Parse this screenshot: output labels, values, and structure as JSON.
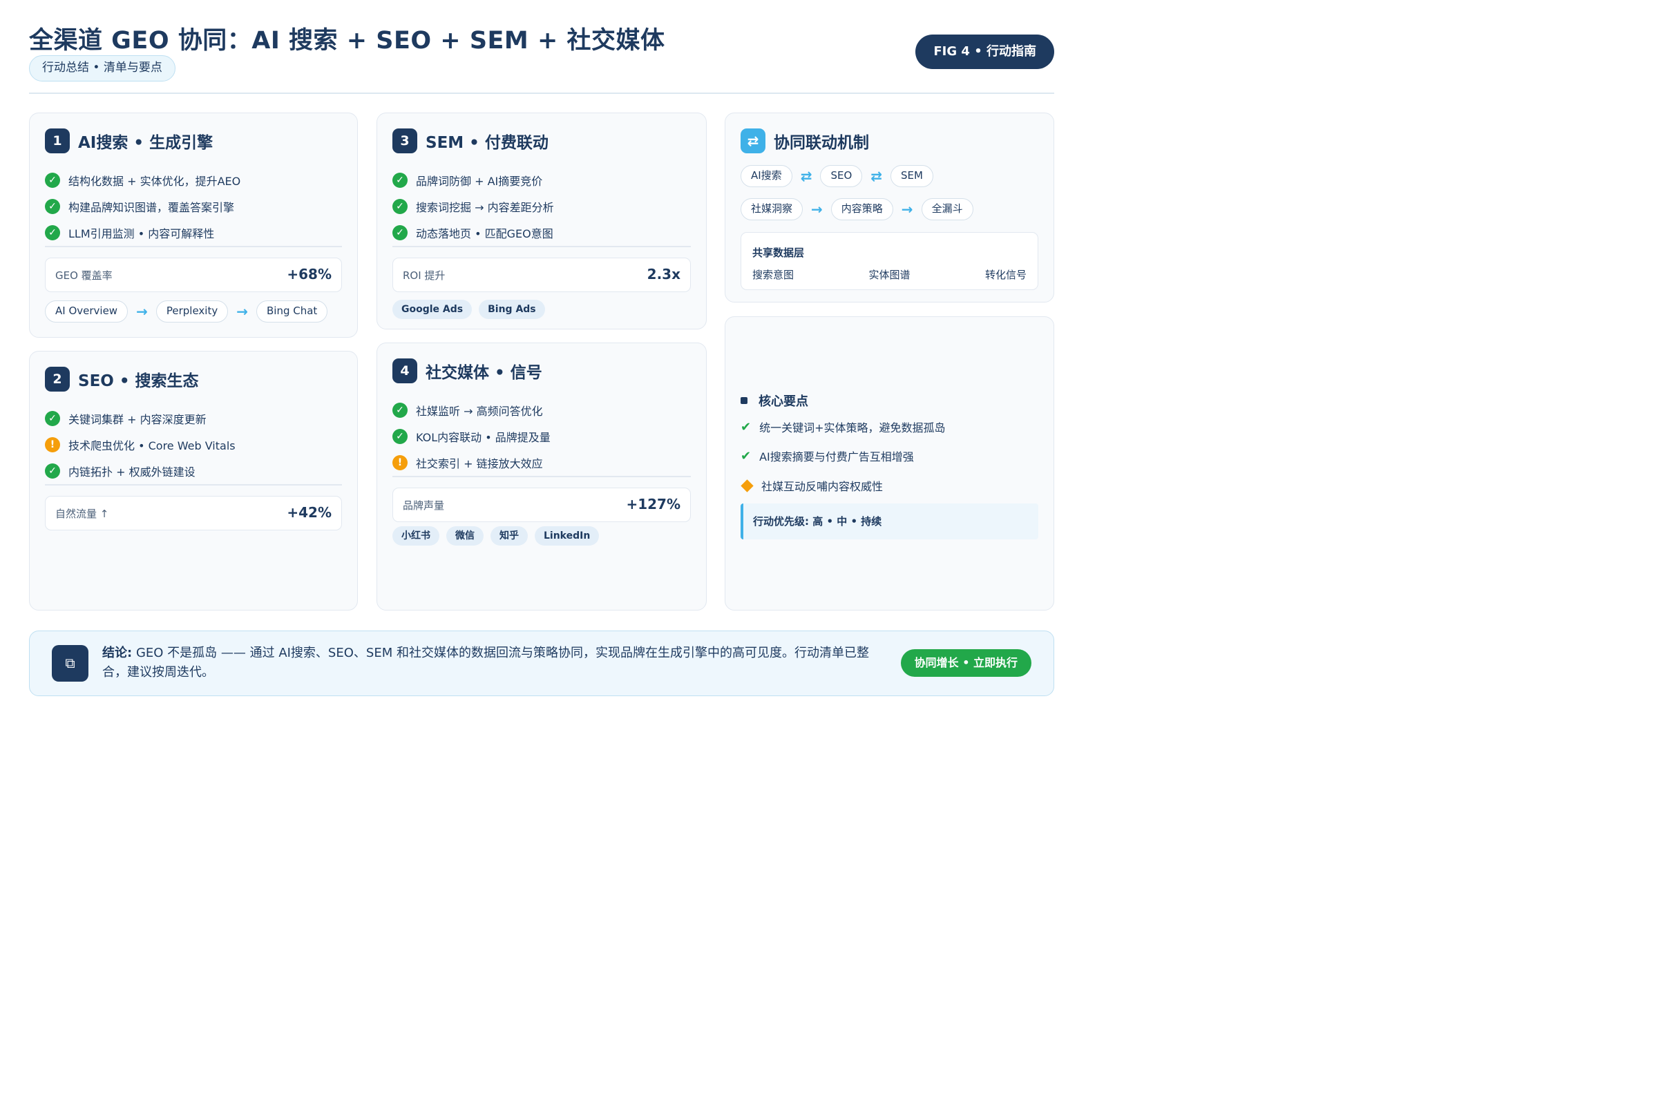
{
  "header": {
    "title": "全渠道 GEO 协同：AI 搜索 + SEO + SEM + 社交媒体",
    "subtitle": "行动总结 • 清单与要点",
    "fig_badge": "FIG 4 • 行动指南"
  },
  "cards": {
    "ai": {
      "num": "1",
      "title": "AI搜索 • 生成引擎",
      "checks": [
        "结构化数据 + 实体优化，提升AEO",
        "构建品牌知识图谱，覆盖答案引擎",
        "LLM引用监测 • 内容可解释性"
      ],
      "metric_label": "GEO 覆盖率",
      "metric_value": "+68%",
      "flow": [
        "AI Overview",
        "Perplexity",
        "Bing Chat"
      ]
    },
    "seo": {
      "num": "2",
      "title": "SEO • 搜索生态",
      "checks": [
        "关键词集群 + 内容深度更新",
        "技术爬虫优化 • Core Web Vitals",
        "内链拓扑 + 权威外链建设"
      ],
      "check_status": [
        "ok",
        "warn",
        "ok"
      ],
      "metric_label": "自然流量 ↑",
      "metric_value": "+42%"
    },
    "sem": {
      "num": "3",
      "title": "SEM • 付费联动",
      "checks": [
        "品牌词防御 + AI摘要竞价",
        "搜索词挖掘 → 内容差距分析",
        "动态落地页 • 匹配GEO意图"
      ],
      "metric_label": "ROI 提升",
      "metric_value": "2.3x",
      "tags": [
        "Google Ads",
        "Bing Ads"
      ]
    },
    "social": {
      "num": "4",
      "title": "社交媒体 • 信号",
      "checks": [
        "社媒监听 → 高频问答优化",
        "KOL内容联动 • 品牌提及量",
        "社交索引 + 链接放大效应"
      ],
      "check_status": [
        "ok",
        "ok",
        "warn"
      ],
      "metric_label": "品牌声量",
      "metric_value": "+127%",
      "tags": [
        "小红书",
        "微信",
        "知乎",
        "LinkedIn"
      ]
    },
    "sync": {
      "icon": "⇄",
      "title": "协同联动机制",
      "row1": [
        "AI搜索",
        "SEO",
        "SEM"
      ],
      "row2": [
        "社媒洞察",
        "内容策略",
        "全漏斗"
      ],
      "shared_title": "共享数据层",
      "shared_items": [
        "搜索意图",
        "实体图谱",
        "转化信号"
      ]
    },
    "keypoints": {
      "title": "核心要点",
      "items": [
        "统一关键词+实体策略，避免数据孤岛",
        "AI搜索摘要与付费广告互相增强",
        "社媒互动反哺内容权威性"
      ],
      "priority": "行动优先级: 高 • 中 • 持续"
    }
  },
  "conclusion": {
    "label": "结论:",
    "text": "GEO 不是孤岛 —— 通过 AI搜索、SEO、SEM 和社交媒体的数据回流与策略协同，实现品牌在生成引擎中的高可见度。行动清单已整合，建议按周迭代。",
    "button": "协同增长 • 立即执行"
  },
  "colors": {
    "navy": "#1e3a5f",
    "accent_blue": "#3fb1e8",
    "ok_green": "#22a84a",
    "warn_amber": "#f59e0b"
  }
}
